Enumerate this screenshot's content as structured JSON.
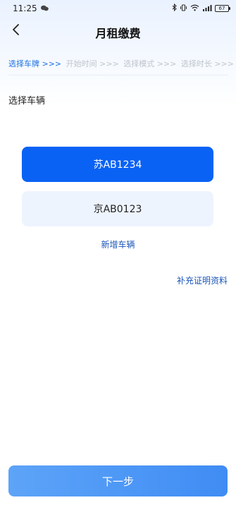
{
  "status_bar": {
    "time": "11:25",
    "battery": "67"
  },
  "nav": {
    "title": "月租缴费"
  },
  "steps": [
    {
      "label": "选择车牌 >>>",
      "active": true
    },
    {
      "label": "开始时间 >>>",
      "active": false
    },
    {
      "label": "选择模式 >>>",
      "active": false
    },
    {
      "label": "选择时长 >>>",
      "active": false
    }
  ],
  "section": {
    "label": "选择车辆"
  },
  "vehicles": [
    {
      "plate": "苏AB1234",
      "selected": true
    },
    {
      "plate": "京AB0123",
      "selected": false
    }
  ],
  "actions": {
    "add_vehicle": "新增车辆",
    "supplement": "补充证明资料",
    "next": "下一步"
  },
  "colors": {
    "accent": "#0a62f5",
    "link": "#1b56b8",
    "step_inactive": "#bfc4cc"
  }
}
